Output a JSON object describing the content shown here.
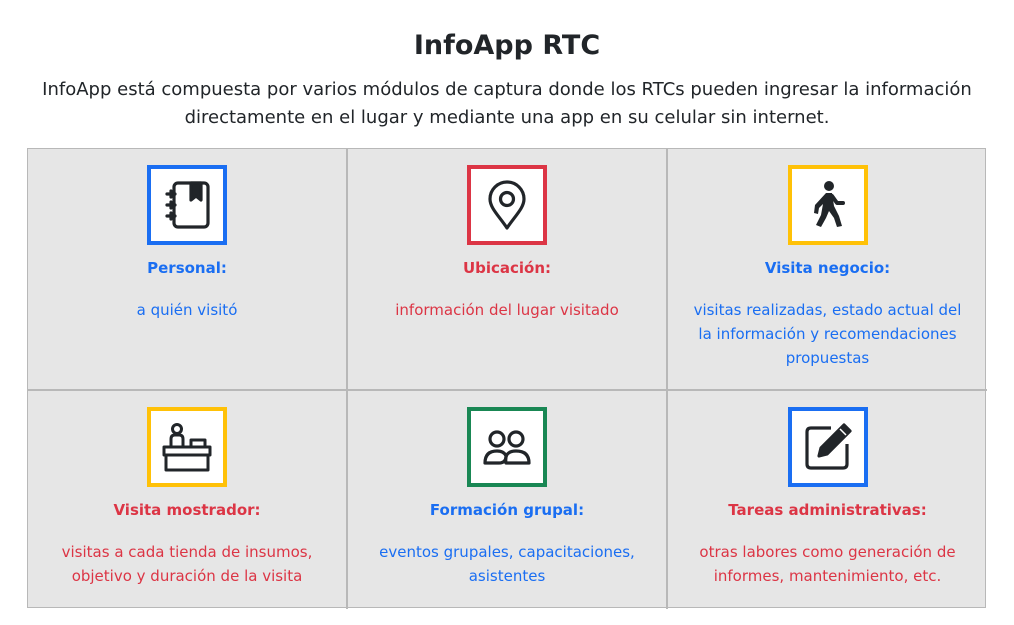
{
  "header": {
    "title": "InfoApp RTC",
    "subtitle": "InfoApp está compuesta por varios módulos de captura donde los RTCs pueden ingresar la información directamente en el lugar y mediante una app en su celular sin internet."
  },
  "colors": {
    "blue": "#1a6ef2",
    "red": "#dc3545",
    "yellow": "#ffc107",
    "green": "#198754",
    "cell_bg": "#e6e6e6"
  },
  "modules": [
    {
      "title": "Personal:",
      "description": "a quién visitó",
      "icon": "address-book-icon",
      "border_color": "#1a6ef2",
      "text_color": "#1a6ef2"
    },
    {
      "title": "Ubicación:",
      "description": "información del lugar visitado",
      "icon": "map-pin-icon",
      "border_color": "#dc3545",
      "text_color": "#dc3545"
    },
    {
      "title": "Visita negocio:",
      "description": "visitas realizadas, estado actual del la información y recomendaciones propuestas",
      "icon": "person-walking-icon",
      "border_color": "#ffc107",
      "text_color": "#1a6ef2"
    },
    {
      "title": "Visita mostrador:",
      "description": "visitas a cada tienda de insumos, objetivo y duración de la visita",
      "icon": "counter-desk-icon",
      "border_color": "#ffc107",
      "text_color": "#dc3545"
    },
    {
      "title": "Formación grupal:",
      "description": "eventos grupales, capacitaciones, asistentes",
      "icon": "people-group-icon",
      "border_color": "#198754",
      "text_color": "#1a6ef2"
    },
    {
      "title": "Tareas administrativas:",
      "description": "otras labores como generación de informes, mantenimiento, etc.",
      "icon": "pencil-square-icon",
      "border_color": "#1a6ef2",
      "text_color": "#dc3545"
    }
  ]
}
